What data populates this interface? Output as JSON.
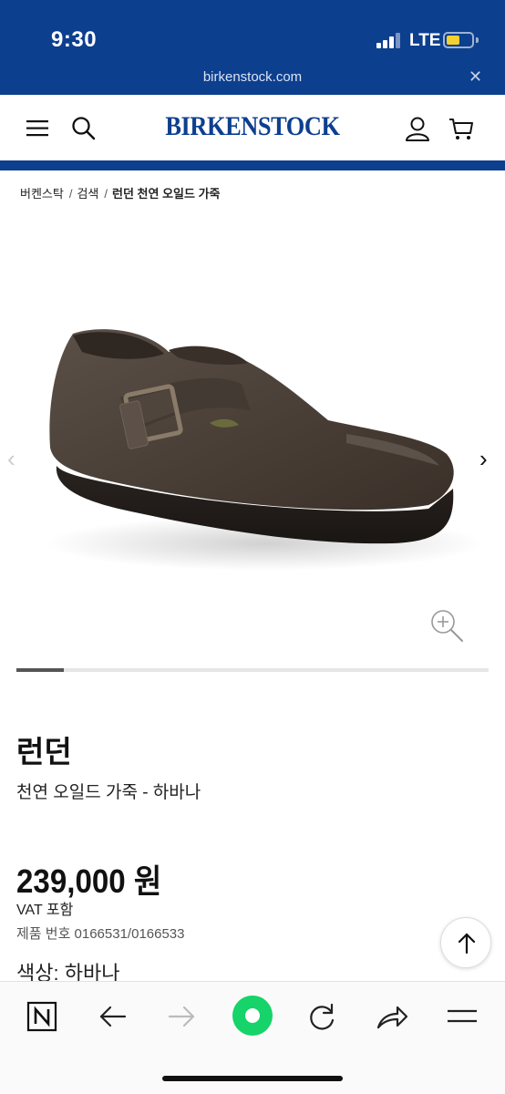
{
  "status_bar": {
    "time": "9:30",
    "network": "LTE"
  },
  "browser": {
    "url": "birkenstock.com"
  },
  "header": {
    "logo": "BIRKENSTOCK",
    "brand_color": "#0d3f8f"
  },
  "breadcrumb": {
    "items": [
      "버켄스탁",
      "검색",
      "런던 천연 오일드 가죽"
    ],
    "separator": "/"
  },
  "gallery": {
    "image_alt": "런던 천연 오일드 가죽 하바나 슈즈",
    "progress": 0.1
  },
  "product": {
    "name": "런던",
    "subtitle": "천연 오일드 가죽 - 하바나",
    "price": "239,000 원",
    "vat": "VAT 포함",
    "sku": "제품 번호 0166531/0166533",
    "color_label": "색상:",
    "color_value": "하바나"
  },
  "icons": {
    "menu": "hamburger-icon",
    "search": "search-icon",
    "account": "user-icon",
    "cart": "cart-icon",
    "zoom": "zoom-in-icon",
    "back_to_top": "arrow-up-icon",
    "toolbar": [
      "naver-icon",
      "back-icon",
      "forward-icon",
      "green-dot-icon",
      "reload-icon",
      "share-icon",
      "menu-icon"
    ]
  }
}
